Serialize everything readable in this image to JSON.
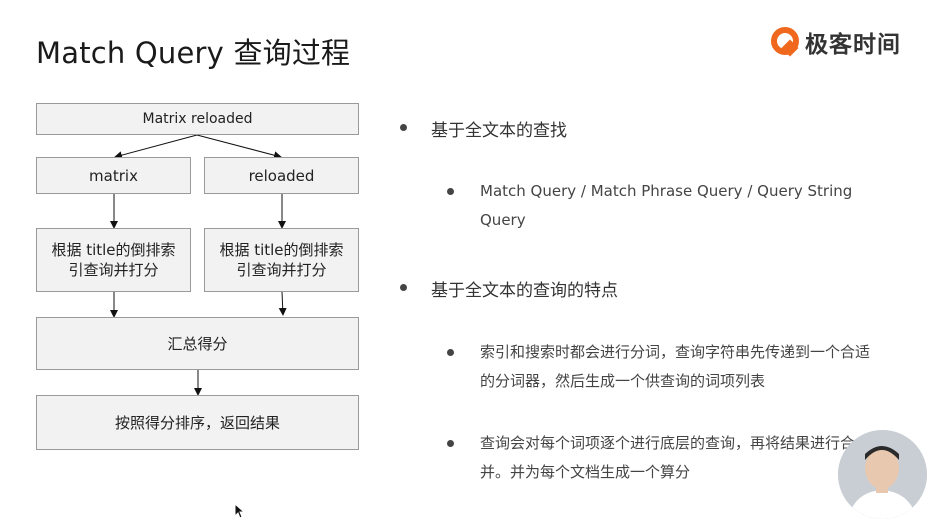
{
  "slide": {
    "title": "Match Query 查询过程"
  },
  "brand": {
    "name": "极客时间",
    "color": "#f0681e"
  },
  "flowchart": {
    "root": "Matrix reloaded",
    "term_left": "matrix",
    "term_right": "reloaded",
    "process_left": "根据 title的倒排索引查询并打分",
    "process_right": "根据 title的倒排索引查询并打分",
    "merge": "汇总得分",
    "result": "按照得分排序，返回结果"
  },
  "bullets": {
    "b1": "基于全文本的查找",
    "b1_sub1": "Match Query / Match Phrase Query / Query String Query",
    "b2": "基于全文本的查询的特点",
    "b2_sub1": "索引和搜索时都会进行分词，查询字符串先传递到一个合适的分词器，然后生成一个供查询的词项列表",
    "b2_sub2": "查询会对每个词项逐个进行底层的查询，再将结果进行合并。并为每个文档生成一个算分"
  }
}
